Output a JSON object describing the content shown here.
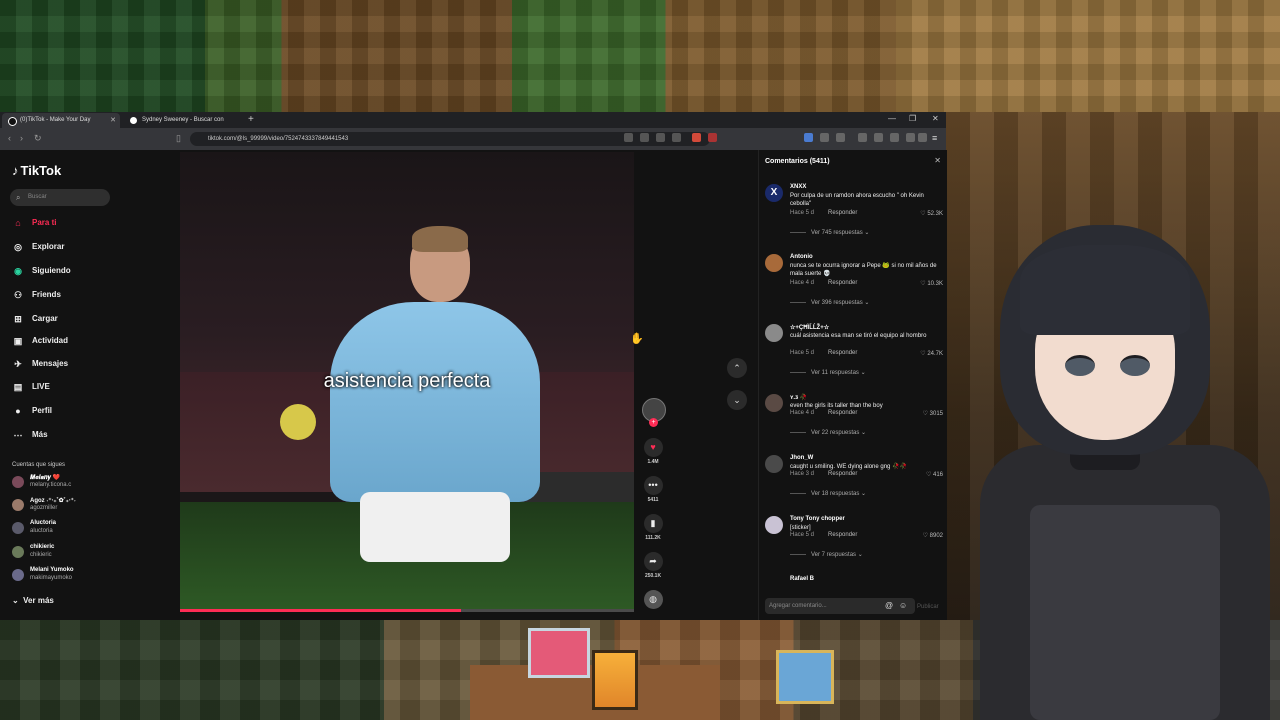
{
  "browser": {
    "tabs": [
      {
        "title": "(0)TikTok - Make Your Day",
        "active": true
      },
      {
        "title": "Sydney Sweeney - Buscar con Google",
        "active": false
      }
    ],
    "url": "tiktok.com/@ls_99999/video/7524743337849441543"
  },
  "tiktok": {
    "logo": "TikTok",
    "search_placeholder": "Buscar",
    "nav": [
      {
        "label": "Para ti",
        "icon": "home-icon",
        "active": true
      },
      {
        "label": "Explorar",
        "icon": "compass-icon"
      },
      {
        "label": "Siguiendo",
        "icon": "following-icon"
      },
      {
        "label": "Friends",
        "icon": "friends-icon"
      },
      {
        "label": "Cargar",
        "icon": "upload-icon"
      },
      {
        "label": "Actividad",
        "icon": "activity-icon"
      },
      {
        "label": "Mensajes",
        "icon": "messages-icon"
      },
      {
        "label": "LIVE",
        "icon": "live-icon"
      },
      {
        "label": "Perfil",
        "icon": "profile-icon"
      },
      {
        "label": "Más",
        "icon": "more-icon"
      }
    ],
    "following_title": "Cuentas que sigues",
    "following": [
      {
        "name": "𝑴𝒆𝒍𝒂𝒏𝒚 ❤️",
        "handle": "melany.ticona.c"
      },
      {
        "name": "Agoz ˖⁺‧₊˚✿˚₊‧⁺˖",
        "handle": "agozmiller"
      },
      {
        "name": "Aluctoria",
        "handle": "aluctoria"
      },
      {
        "name": "chikieric",
        "handle": "chikieric"
      },
      {
        "name": "Melani Yumoko",
        "handle": "makimayumoko"
      }
    ],
    "see_more": "Ver más"
  },
  "video": {
    "caption": "asistencia perfecta",
    "progress": 0.62,
    "actions": {
      "likes": "1.4M",
      "comments": "5411",
      "saves": "111.2K",
      "shares": "250.1K"
    }
  },
  "comments_panel": {
    "title": "Comentarios (5411)",
    "input_placeholder": "Agregar comentario...",
    "post_label": "Publicar",
    "reply_label": "Responder",
    "items": [
      {
        "name": "XNXX",
        "text": "Por culpa de un ramdon ahora escucho \" oh Kevin cebolla\"",
        "time": "Hace 5 d",
        "likes": "52.3K",
        "replies": "Ver 745 respuestas"
      },
      {
        "name": "Antonio",
        "text": "nunca se te ocurra ignorar a Pepe 🐸 si no mil años de mala suerte 💀",
        "time": "Hace 4 d",
        "likes": "10.3K",
        "replies": "Ver 396 respuestas"
      },
      {
        "name": "☆+ÇĦÏĹĹŽ+☆",
        "text": "cuál asistencia esa man se tiró el equipo al hombro",
        "time": "Hace 5 d",
        "likes": "24.7K",
        "replies": "Ver 11 respuestas"
      },
      {
        "name": "ʏ.ᴣ 🥀",
        "text": "even the girls its taller than the boy",
        "time": "Hace 4 d",
        "likes": "3015",
        "replies": "Ver 22 respuestas"
      },
      {
        "name": "Jhon_W",
        "text": "caught u smiling. WE dying alone gng 🥀🥀",
        "time": "Hace 3 d",
        "likes": "416",
        "replies": "Ver 18 respuestas"
      },
      {
        "name": "Tony Tony chopper",
        "text": "[sticker]",
        "time": "Hace 5 d",
        "likes": "8902",
        "replies": "Ver 7 respuestas"
      },
      {
        "name": "Rafael B",
        "text": "",
        "time": "",
        "likes": "",
        "replies": ""
      }
    ]
  },
  "colors": {
    "accent": "#fe2c55",
    "bg": "#121212"
  }
}
